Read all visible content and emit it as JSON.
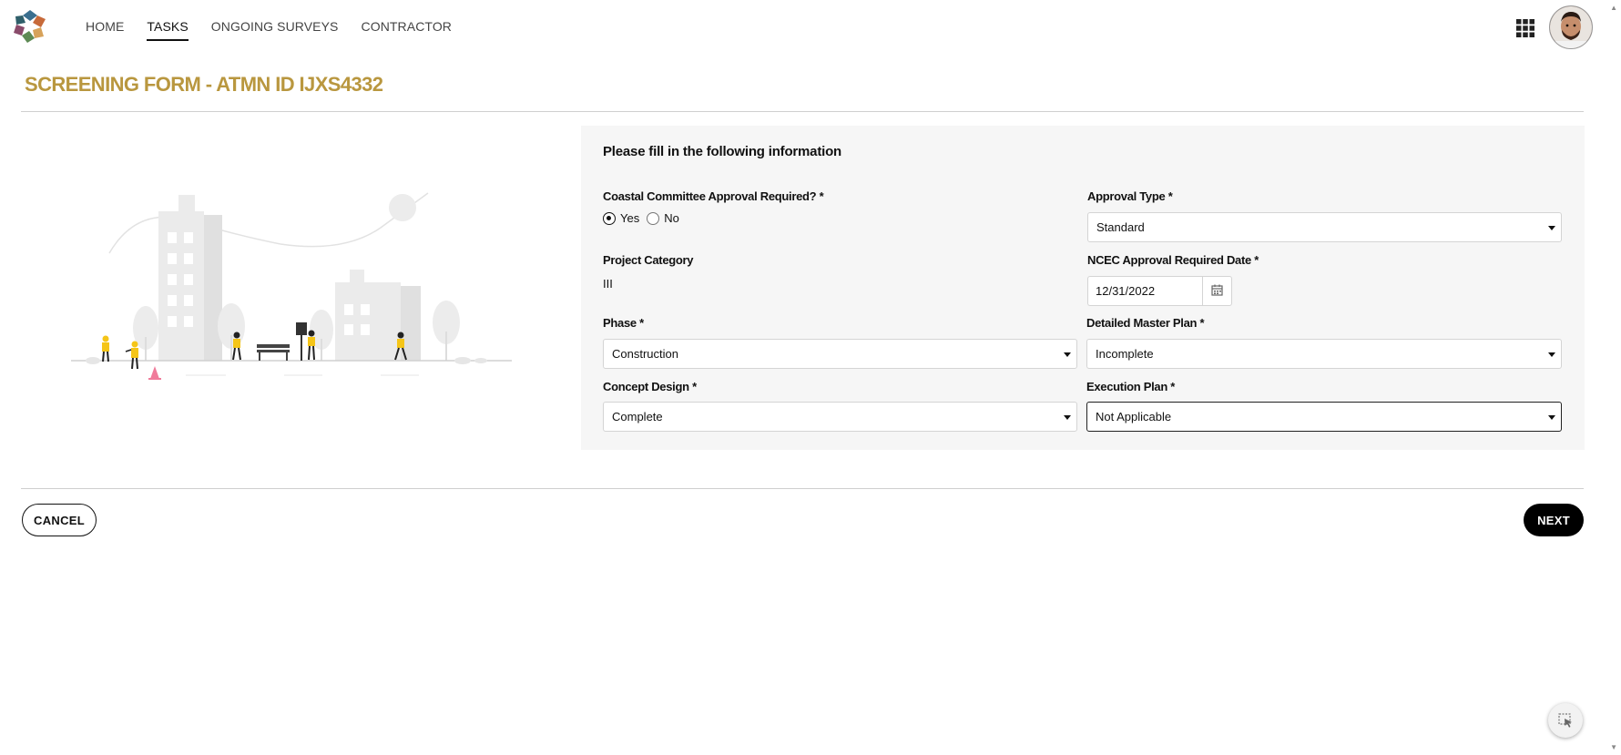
{
  "nav": {
    "items": [
      {
        "label": "HOME"
      },
      {
        "label": "TASKS"
      },
      {
        "label": "ONGOING SURVEYS"
      },
      {
        "label": "CONTRACTOR"
      }
    ],
    "active": "TASKS"
  },
  "page": {
    "title": "SCREENING FORM - ATMN ID IJXS4332"
  },
  "form": {
    "heading": "Please fill in the following information",
    "coastal": {
      "label": "Coastal Committee Approval Required? *",
      "options": [
        {
          "label": "Yes",
          "checked": true
        },
        {
          "label": "No",
          "checked": false
        }
      ]
    },
    "approval_type": {
      "label": "Approval Type *",
      "value": "Standard"
    },
    "project_category": {
      "label": "Project Category",
      "value": "III"
    },
    "ncec_date": {
      "label": "NCEC Approval Required Date *",
      "value": "12/31/2022"
    },
    "phase": {
      "label": "Phase *",
      "value": "Construction"
    },
    "detailed_master_plan": {
      "label": "Detailed Master Plan *",
      "value": "Incomplete"
    },
    "concept_design": {
      "label": "Concept Design *",
      "value": "Complete"
    },
    "execution_plan": {
      "label": "Execution Plan *",
      "value": "Not Applicable"
    }
  },
  "actions": {
    "cancel": "CANCEL",
    "next": "NEXT"
  },
  "colors": {
    "accent": "#b9973f",
    "panel": "#f6f6f6",
    "primary_button": "#000000"
  },
  "icons": {
    "apps": "apps-grid-icon",
    "calendar": "calendar-icon",
    "cursor_help": "cursor-select-icon"
  }
}
